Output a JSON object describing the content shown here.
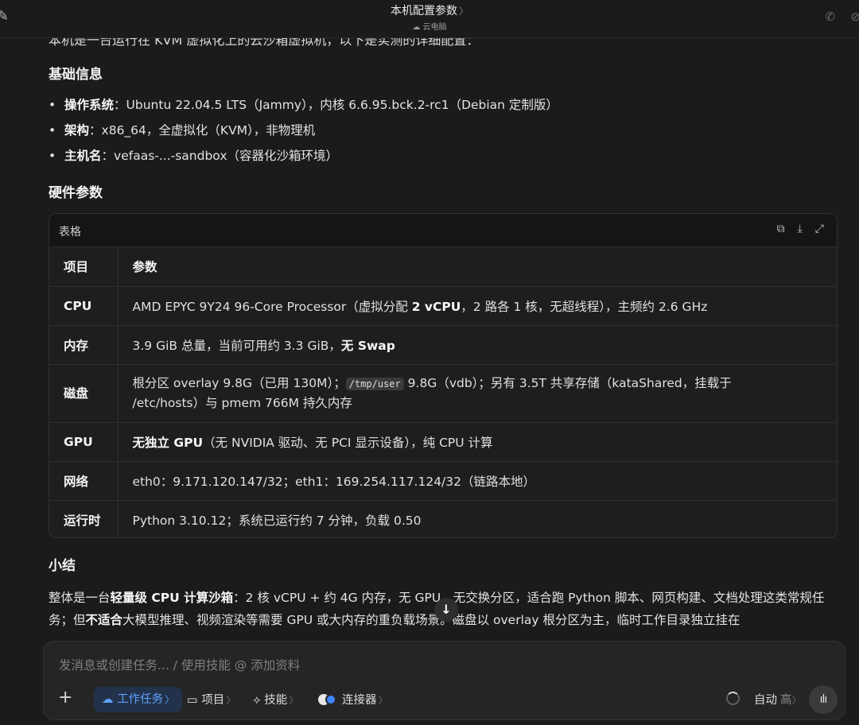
{
  "header": {
    "title": "本机配置参数",
    "title_chevron": "〉",
    "subtitle": "云电脑",
    "icons": [
      "edit-icon",
      "phone-icon",
      "mute-icon",
      "cloud-icon"
    ]
  },
  "intro_cut": "本机是一台运行在 KVM 虚拟化上的云沙箱虚拟机，以下是实测的详细配置：",
  "sections": {
    "basic_title": "基础信息",
    "hardware_title": "硬件参数",
    "summary_title": "小结"
  },
  "basic": [
    {
      "key": "操作系统",
      "sep": "：",
      "value": "Ubuntu 22.04.5 LTS（Jammy），内核 6.6.95.bck.2-rc1（Debian 定制版）"
    },
    {
      "key": "架构",
      "sep": "：",
      "value": "x86_64，全虚拟化（KVM），非物理机"
    },
    {
      "key": "主机名",
      "sep": "：",
      "value": "vefaas-...-sandbox（容器化沙箱环境）"
    }
  ],
  "table": {
    "label": "表格",
    "header": {
      "k": "项目",
      "v": "参数"
    },
    "rows": {
      "cpu": {
        "k": "CPU",
        "pre": "AMD EPYC 9Y24 96-Core Processor（虚拟分配 ",
        "bold": "2 vCPU",
        "post": "，2 路各 1 核，无超线程），主频约 2.6 GHz"
      },
      "mem": {
        "k": "内存",
        "pre": "3.9 GiB 总量，当前可用约 3.3 GiB，",
        "bold": "无 Swap"
      },
      "disk": {
        "k": "磁盘",
        "pre": "根分区 overlay 9.8G（已用 130M）；",
        "code": "/tmp/user",
        "post": " 9.8G（vdb）；另有 3.5T 共享存储（kataShared，挂载于",
        "line2": "/etc/hosts）与 pmem 766M 持久内存"
      },
      "gpu": {
        "k": "GPU",
        "bold": "无独立 GPU",
        "post": "（无 NVIDIA 驱动、无 PCI 显示设备），纯 CPU 计算"
      },
      "net": {
        "k": "网络",
        "v": "eth0：9.171.120.147/32；eth1：169.254.117.124/32（链路本地）"
      },
      "runtime": {
        "k": "运行时",
        "v": "Python 3.10.12；系统已运行约 7 分钟，负载 0.50"
      }
    }
  },
  "summary": {
    "p1": "整体是一台",
    "b1": "轻量级 CPU 计算沙箱",
    "p2": "：2 核 vCPU + 约 4G 内存，无 GPU、无交换分区，适合跑 Python 脚本、网页构建、文档处理这类常规任务；但",
    "b2": "不适合",
    "p3": "大模型推理、视频渲染等需要 GPU 或大内存的重负载场景。磁盘以 overlay 根分区为主，临时工作目录独立挂在"
  },
  "composer": {
    "placeholder": "发消息或创建任务... / 使用技能 @ 添加资料",
    "chips": {
      "work": "工作任务",
      "project": "项目",
      "skills": "技能",
      "connector": "连接器"
    },
    "chev": "〉",
    "mode": "自动",
    "level": "高"
  }
}
